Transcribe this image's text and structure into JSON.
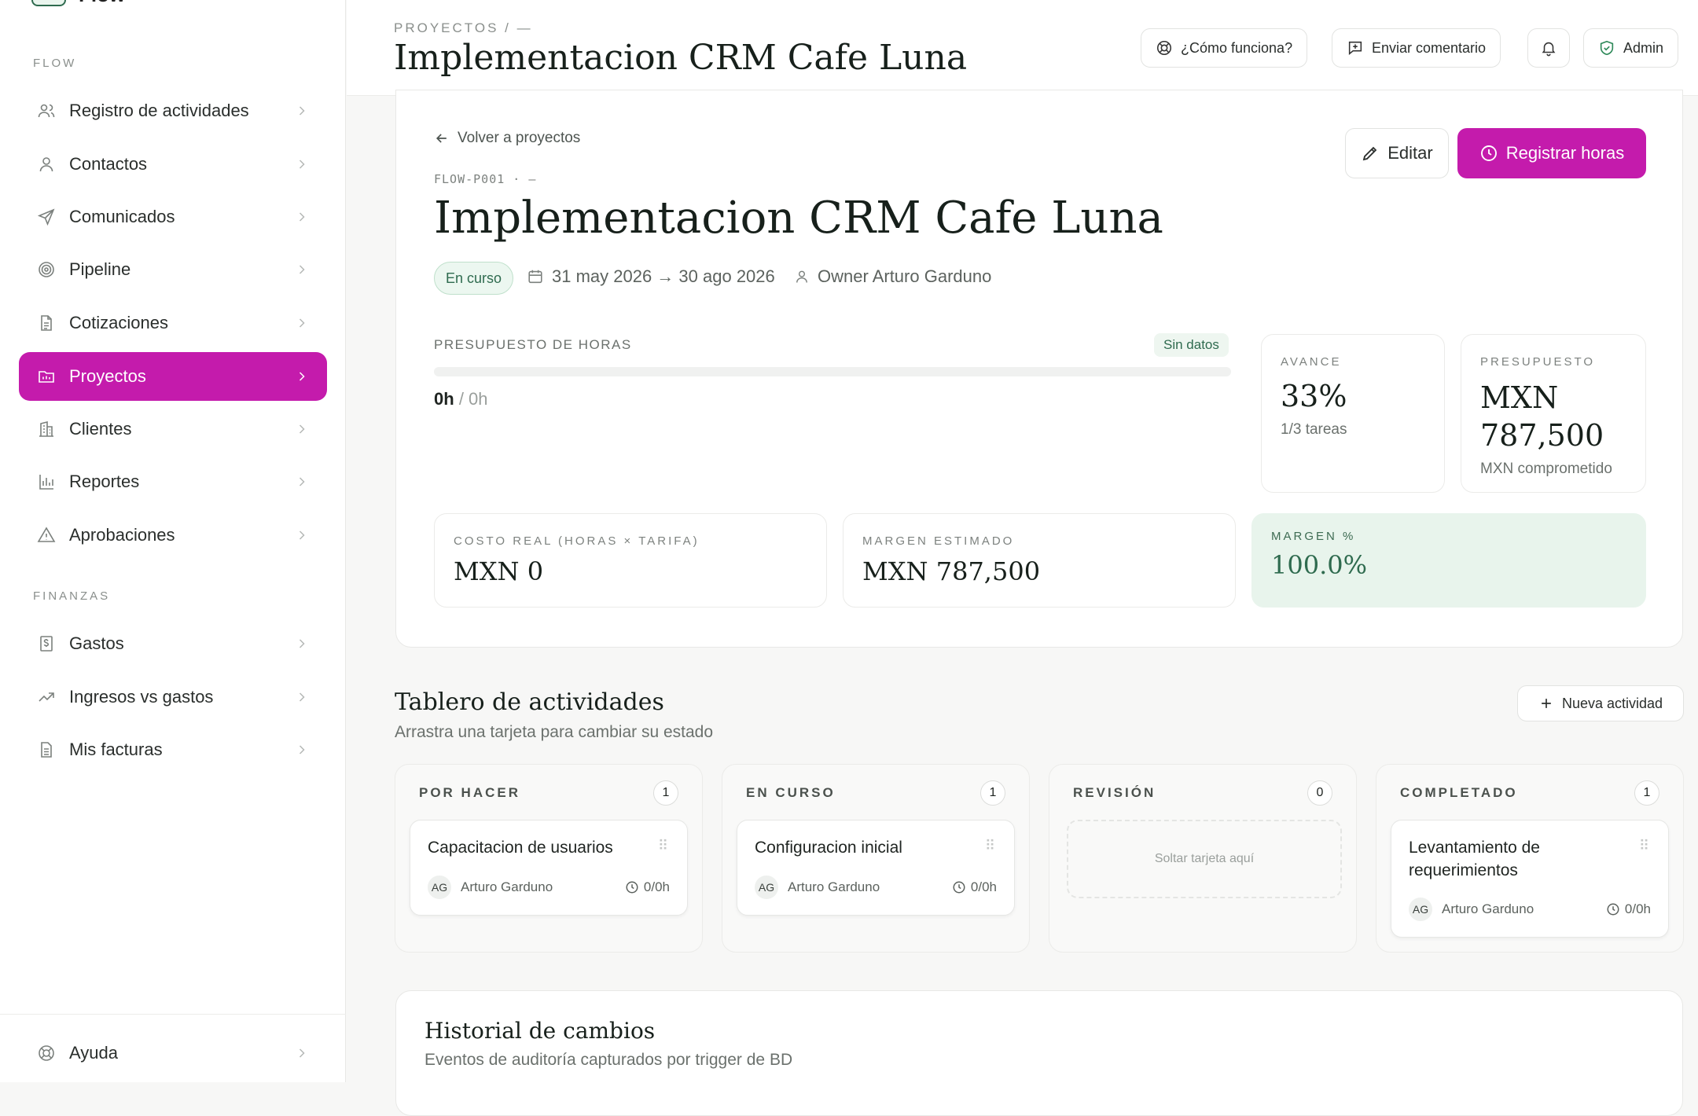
{
  "sidebar": {
    "brand": "Flow",
    "section_flow": "FLOW",
    "section_finanzas": "FINANZAS",
    "flow_items": [
      {
        "label": "Registro de actividades",
        "icon": "users-icon"
      },
      {
        "label": "Contactos",
        "icon": "user-icon"
      },
      {
        "label": "Comunicados",
        "icon": "send-icon"
      },
      {
        "label": "Pipeline",
        "icon": "target-icon"
      },
      {
        "label": "Cotizaciones",
        "icon": "document-icon"
      },
      {
        "label": "Proyectos",
        "icon": "folder-icon",
        "active": true
      },
      {
        "label": "Clientes",
        "icon": "building-icon"
      },
      {
        "label": "Reportes",
        "icon": "bar-chart-icon"
      },
      {
        "label": "Aprobaciones",
        "icon": "warning-icon"
      }
    ],
    "finanzas_items": [
      {
        "label": "Gastos",
        "icon": "receipt-icon"
      },
      {
        "label": "Ingresos vs gastos",
        "icon": "trend-icon"
      },
      {
        "label": "Mis facturas",
        "icon": "invoice-icon"
      }
    ],
    "help": "Ayuda"
  },
  "topbar": {
    "breadcrumb": "PROYECTOS / —",
    "title": "Implementacion CRM Cafe Luna",
    "how_label": "¿Cómo funciona?",
    "feedback_label": "Enviar comentario",
    "admin_label": "Admin"
  },
  "project": {
    "back_label": "Volver a proyectos",
    "code": "FLOW-P001 · —",
    "title": "Implementacion CRM Cafe Luna",
    "status": "En curso",
    "dates": "31 may 2026 → 30 ago 2026",
    "owner": "Owner Arturo Garduno",
    "edit_label": "Editar",
    "log_hours_label": "Registrar horas",
    "budget_hours": {
      "caption": "PRESUPUESTO DE HORAS",
      "badge": "Sin datos",
      "used": "0h",
      "total": "/ 0h",
      "progress": 0
    },
    "avance": {
      "caption": "AVANCE",
      "value": "33%",
      "sub": "1/3 tareas"
    },
    "presupuesto": {
      "caption": "PRESUPUESTO",
      "value": "MXN 787,500",
      "sub": "MXN comprometido"
    },
    "costo": {
      "caption": "COSTO REAL (HORAS × TARIFA)",
      "value": "MXN 0"
    },
    "margen_est": {
      "caption": "MARGEN ESTIMADO",
      "value": "MXN 787,500"
    },
    "margen_pct": {
      "caption": "MARGEN %",
      "value": "100.0%"
    }
  },
  "board": {
    "title": "Tablero de actividades",
    "subtitle": "Arrastra una tarjeta para cambiar su estado",
    "new_label": "Nueva actividad",
    "columns": [
      {
        "name": "POR HACER",
        "count": "1",
        "tasks": [
          {
            "title": "Capacitacion de usuarios",
            "initials": "AG",
            "owner": "Arturo Garduno",
            "hours": "0/0h"
          }
        ]
      },
      {
        "name": "EN CURSO",
        "count": "1",
        "tasks": [
          {
            "title": "Configuracion inicial",
            "initials": "AG",
            "owner": "Arturo Garduno",
            "hours": "0/0h"
          }
        ]
      },
      {
        "name": "REVISIÓN",
        "count": "0",
        "drop_label": "Soltar tarjeta aquí"
      },
      {
        "name": "COMPLETADO",
        "count": "1",
        "tasks": [
          {
            "title": "Levantamiento de requerimientos",
            "initials": "AG",
            "owner": "Arturo Garduno",
            "hours": "0/0h"
          }
        ]
      }
    ]
  },
  "history": {
    "title": "Historial de cambios",
    "subtitle": "Eventos de auditoría capturados por trigger de BD"
  },
  "colors": {
    "accent": "#c41bac",
    "success_bg": "#e8f4ec",
    "success_text": "#2f6b4f"
  }
}
